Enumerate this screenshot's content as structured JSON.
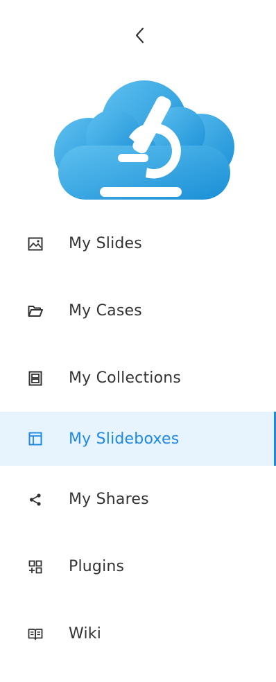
{
  "sidebar": {
    "collapse_icon": "chevron-left-icon",
    "logo_icon": "cloud-microscope-logo",
    "accent_color": "#1e88e5",
    "active_background": "#e8f4fd",
    "items": [
      {
        "label": "My Slides",
        "icon": "image-icon",
        "active": false
      },
      {
        "label": "My Cases",
        "icon": "folder-open-icon",
        "active": false
      },
      {
        "label": "My Collections",
        "icon": "collection-icon",
        "active": false
      },
      {
        "label": "My Slideboxes",
        "icon": "slidebox-icon",
        "active": true
      },
      {
        "label": "My Shares",
        "icon": "share-icon",
        "active": false
      },
      {
        "label": "Plugins",
        "icon": "plugins-icon",
        "active": false
      },
      {
        "label": "Wiki",
        "icon": "book-icon",
        "active": false
      }
    ]
  }
}
